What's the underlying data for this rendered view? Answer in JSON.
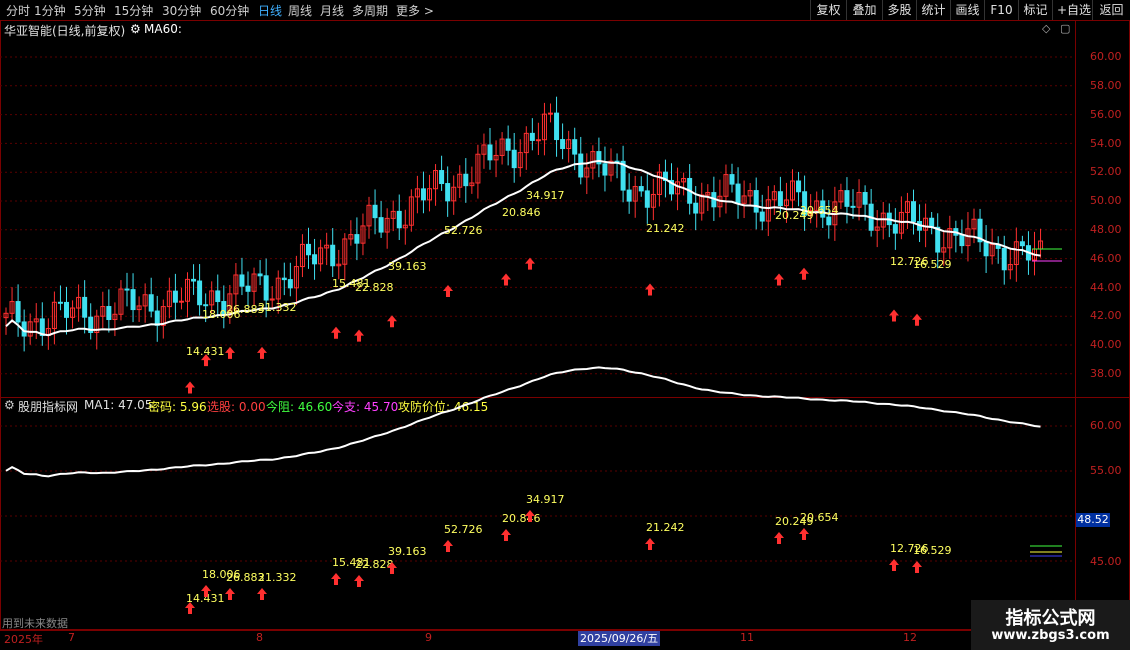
{
  "periods": [
    "分时",
    "1分钟",
    "5分钟",
    "15分钟",
    "30分钟",
    "60分钟",
    "日线",
    "周线",
    "月线",
    "多周期",
    "更多 >"
  ],
  "active_period": "日线",
  "tools": [
    "复权",
    "叠加",
    "多股",
    "统计",
    "画线",
    "F10",
    "标记",
    "+自选",
    "返回"
  ],
  "main_title": {
    "stock": "华亚智能(日线,前复权)",
    "ma_label": "MA60:"
  },
  "indicator_title": {
    "name": "股朋指标网",
    "items": [
      {
        "label": "MA1:",
        "value": "47.05",
        "color": "#e0e0e0"
      },
      {
        "label": "密码:",
        "value": "5.96",
        "color": "#ffff40"
      },
      {
        "label": "选股:",
        "value": "0.00",
        "color": "#ff4040"
      },
      {
        "label": "今阻:",
        "value": "46.60",
        "color": "#40ff40"
      },
      {
        "label": "今支:",
        "value": "45.70",
        "color": "#ff40ff"
      },
      {
        "label": "攻防价位:",
        "value": "46.15",
        "color": "#ffff40"
      }
    ]
  },
  "main_axis": [
    "60.00",
    "58.00",
    "56.00",
    "54.00",
    "52.00",
    "50.00",
    "48.00",
    "46.00",
    "44.00",
    "42.00",
    "40.00",
    "38.00"
  ],
  "ind_axis": [
    "60.00",
    "55.00",
    "45.00"
  ],
  "ind_current": "48.52",
  "footer_note": "用到未来数据",
  "dates": [
    {
      "text": "2025年"
    },
    {
      "text": "7"
    },
    {
      "text": "8"
    },
    {
      "text": "9"
    },
    {
      "text": "11"
    },
    {
      "text": "12"
    }
  ],
  "cursor_date": "2025/09/26/五",
  "watermark": {
    "line1": "指标公式网",
    "line2": "www.zbgs3.com"
  },
  "colors": {
    "up": "#ff3030",
    "down": "#40e0f0",
    "ma": "#ffffff",
    "grid": "#5a0000",
    "label": "#ffff60"
  },
  "chart_data": {
    "type": "candlestick",
    "signals": [
      {
        "label": "14.431",
        "price": 40.8
      },
      {
        "label": "18.006",
        "price": 42.7
      },
      {
        "label": "26.883",
        "price": 43.2
      },
      {
        "label": "21.332",
        "price": 43.2
      },
      {
        "label": "15.481",
        "price": 44.6
      },
      {
        "label": "22.828",
        "price": 44.4
      },
      {
        "label": "39.163",
        "price": 45.4
      },
      {
        "label": "52.726",
        "price": 47.5
      },
      {
        "label": "20.846",
        "price": 48.3
      },
      {
        "label": "34.917",
        "price": 49.4
      },
      {
        "label": "21.242",
        "price": 47.6
      },
      {
        "label": "20.249",
        "price": 48.3
      },
      {
        "label": "20.654",
        "price": 48.7
      },
      {
        "label": "12.726",
        "price": 45.8
      },
      {
        "label": "16.529",
        "price": 45.5
      }
    ]
  }
}
